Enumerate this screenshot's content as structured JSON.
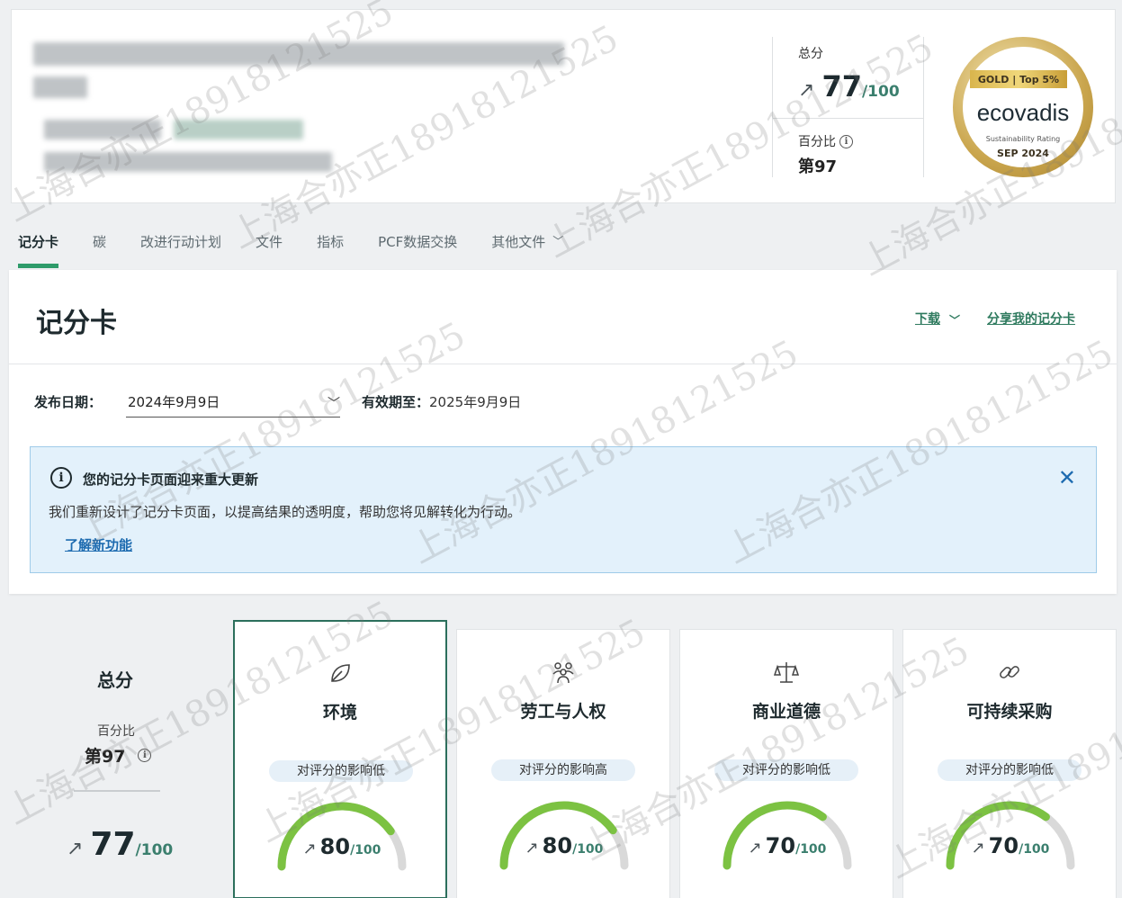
{
  "header": {
    "total_label": "总分",
    "score": "77",
    "score_max": "/100",
    "percentile_label": "百分比",
    "percentile": "第97",
    "medal": {
      "ribbon": "GOLD | Top 5%",
      "brand": "ecovadis",
      "subtitle": "Sustainability Rating",
      "date": "SEP 2024"
    }
  },
  "tabs": [
    {
      "label": "记分卡"
    },
    {
      "label": "碳"
    },
    {
      "label": "改进行动计划"
    },
    {
      "label": "文件"
    },
    {
      "label": "指标"
    },
    {
      "label": "PCF数据交换"
    },
    {
      "label": "其他文件"
    }
  ],
  "scorecard": {
    "title": "记分卡",
    "download_label": "下载",
    "share_label": "分享我的记分卡",
    "publish_label": "发布日期：",
    "publish_value": "2024年9月9日",
    "valid_label": "有效期至：",
    "valid_value": "2025年9月9日",
    "notice": {
      "title": "您的记分卡页面迎来重大更新",
      "body": "我们重新设计了记分卡页面，以提高结果的透明度，帮助您将见解转化为行动。",
      "link": "了解新功能"
    }
  },
  "summary": {
    "title": "总分",
    "percentile_label": "百分比",
    "percentile": "第97",
    "score": "77",
    "score_max": "/100"
  },
  "themes": [
    {
      "name": "环境",
      "impact": "对评分的影响低",
      "score": "80",
      "max": "/100",
      "icon": "leaf-icon"
    },
    {
      "name": "劳工与人权",
      "impact": "对评分的影响高",
      "score": "80",
      "max": "/100",
      "icon": "people-icon"
    },
    {
      "name": "商业道德",
      "impact": "对评分的影响低",
      "score": "70",
      "max": "/100",
      "icon": "scales-icon"
    },
    {
      "name": "可持续采购",
      "impact": "对评分的影响低",
      "score": "70",
      "max": "/100",
      "icon": "link-icon"
    }
  ],
  "watermark": "上海合亦正18918121525",
  "colors": {
    "accent": "#2e9b6a",
    "gauge_fill": "#7cc242",
    "gauge_track": "#d9d9d9",
    "link": "#1d6bb0"
  }
}
